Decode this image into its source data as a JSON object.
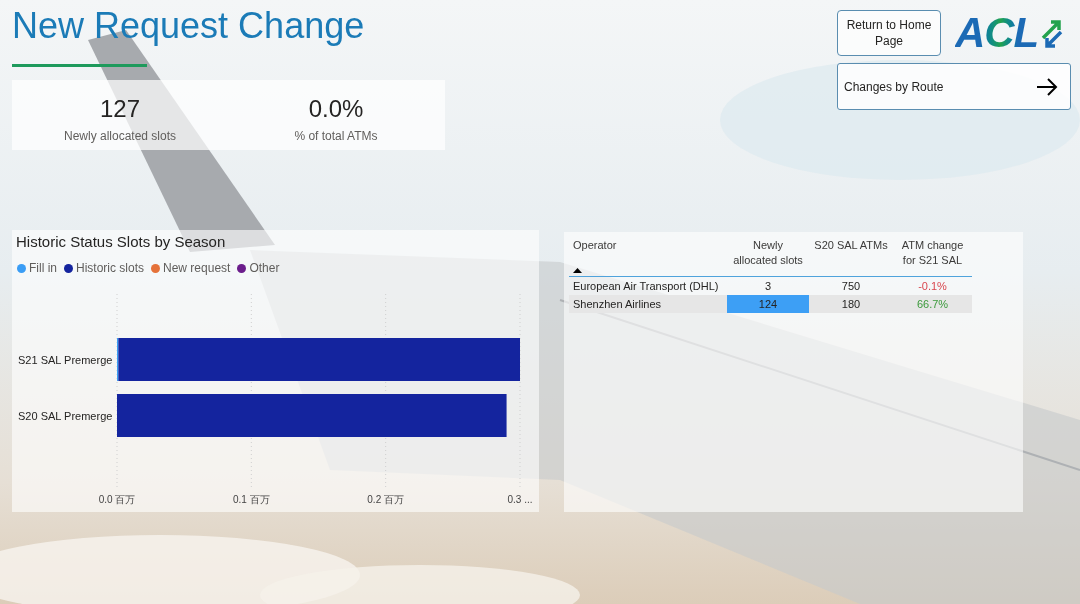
{
  "title": "New Request Change",
  "kpis": [
    {
      "value": "127",
      "label": "Newly allocated slots"
    },
    {
      "value": "0.0%",
      "label": "% of total ATMs"
    }
  ],
  "nav": {
    "home_button": "Return to Home Page",
    "route_button": "Changes by Route"
  },
  "logo": {
    "text": "ACL"
  },
  "chart": {
    "chart_data": {
      "type": "bar",
      "title": "Historic Status Slots by Season",
      "orientation": "horizontal",
      "stacked": true,
      "categories": [
        "S21 SAL Premerge",
        "S20 SAL Premerge"
      ],
      "series": [
        {
          "name": "Fill in",
          "color": "#3a9df5",
          "values": [
            0.001,
            null
          ]
        },
        {
          "name": "Historic slots",
          "color": "#14249e",
          "values": [
            0.299,
            0.29
          ]
        },
        {
          "name": "New request",
          "color": "#e5723a",
          "values": [
            null,
            null
          ]
        },
        {
          "name": "Other",
          "color": "#6b1d8c",
          "values": [
            null,
            null
          ]
        }
      ],
      "xlim": [
        0,
        0.3
      ],
      "xticks": [
        {
          "value": 0,
          "label": "0.0 百万"
        },
        {
          "value": 0.1,
          "label": "0.1 百万"
        },
        {
          "value": 0.2,
          "label": "0.2 百万"
        },
        {
          "value": 0.3,
          "label": "0.3 ..."
        }
      ]
    }
  },
  "table": {
    "columns": [
      {
        "label": "Operator",
        "sorted": true
      },
      {
        "label": "Newly allocated slots",
        "sorted": false
      },
      {
        "label": "S20 SAL ATMs",
        "sorted": false
      },
      {
        "label": "ATM change for S21 SAL",
        "sorted": false
      }
    ],
    "rows": [
      {
        "cells": [
          {
            "text": "European Air Transport (DHL)"
          },
          {
            "text": "3",
            "highlighted": false
          },
          {
            "text": "750"
          },
          {
            "text": "-0.1%",
            "kind": "decrease"
          }
        ]
      },
      {
        "cells": [
          {
            "text": "Shenzhen Airlines"
          },
          {
            "text": "124",
            "highlighted": true
          },
          {
            "text": "180"
          },
          {
            "text": "66.7%",
            "kind": "increase"
          }
        ]
      }
    ]
  }
}
